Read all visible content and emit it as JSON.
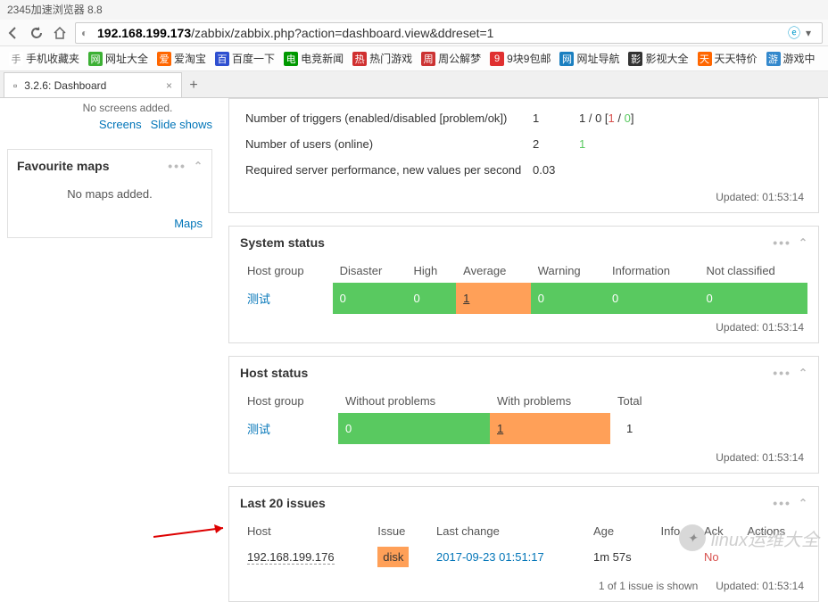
{
  "browser": {
    "title": "2345加速浏览器 8.8",
    "url_host": "192.168.199.173",
    "url_path": "/zabbix/zabbix.php?action=dashboard.view&ddreset=1"
  },
  "bookmarks": [
    {
      "label": "手机收藏夹",
      "color": "#888",
      "bg": "#fff"
    },
    {
      "label": "网址大全",
      "color": "#fff",
      "bg": "#3cb034"
    },
    {
      "label": "爱淘宝",
      "color": "#fff",
      "bg": "#ff6600"
    },
    {
      "label": "百度一下",
      "color": "#fff",
      "bg": "#2e4fd0"
    },
    {
      "label": "电竞新闻",
      "color": "#fff",
      "bg": "#009900"
    },
    {
      "label": "热门游戏",
      "color": "#fff",
      "bg": "#d03030"
    },
    {
      "label": "周公解梦",
      "color": "#fff",
      "bg": "#cc3333"
    },
    {
      "label": "9块9包邮",
      "color": "#fff",
      "bg": "#e03030"
    },
    {
      "label": "网址导航",
      "color": "#fff",
      "bg": "#1a7fc0"
    },
    {
      "label": "影视大全",
      "color": "#fff",
      "bg": "#333"
    },
    {
      "label": "天天特价",
      "color": "#fff",
      "bg": "#ff6600"
    },
    {
      "label": "游戏中",
      "color": "#fff",
      "bg": "#3388cc"
    }
  ],
  "tab": {
    "title": "3.2.6: Dashboard"
  },
  "sidebar": {
    "truncated": "No screens added.",
    "screens_link": "Screens",
    "slideshows_link": "Slide shows",
    "fav_maps_title": "Favourite maps",
    "no_maps": "No maps added.",
    "maps_link": "Maps"
  },
  "overview": {
    "rows": [
      {
        "label": "Number of triggers (enabled/disabled [problem/ok])",
        "v1": "1",
        "v2": "1 / 0 [",
        "v2_red": "1",
        "v2_mid": " / ",
        "v2_green": "0",
        "v2_end": "]"
      },
      {
        "label": "Number of users (online)",
        "v1": "2",
        "v2_green_only": "1"
      },
      {
        "label": "Required server performance, new values per second",
        "v1": "0.03",
        "v2": ""
      }
    ],
    "updated": "Updated: 01:53:14"
  },
  "system_status": {
    "title": "System status",
    "headers": [
      "Host group",
      "Disaster",
      "High",
      "Average",
      "Warning",
      "Information",
      "Not classified"
    ],
    "row": {
      "group": "测试",
      "disaster": "0",
      "high": "0",
      "average": "1",
      "warning": "0",
      "information": "0",
      "not_classified": "0"
    },
    "updated": "Updated: 01:53:14"
  },
  "host_status": {
    "title": "Host status",
    "headers": [
      "Host group",
      "Without problems",
      "With problems",
      "Total"
    ],
    "row": {
      "group": "测试",
      "without": "0",
      "with": "1",
      "total": "1"
    },
    "updated": "Updated: 01:53:14"
  },
  "issues": {
    "title": "Last 20 issues",
    "headers": [
      "Host",
      "Issue",
      "Last change",
      "Age",
      "Info",
      "Ack",
      "Actions"
    ],
    "row": {
      "host": "192.168.199.176",
      "issue": "disk",
      "last_change": "2017-09-23 01:51:17",
      "age": "1m 57s",
      "info": "",
      "ack": "No",
      "actions": ""
    },
    "footer_count": "1 of 1 issue is shown",
    "updated": "Updated: 01:53:14"
  },
  "watermark": "linux运维大全"
}
